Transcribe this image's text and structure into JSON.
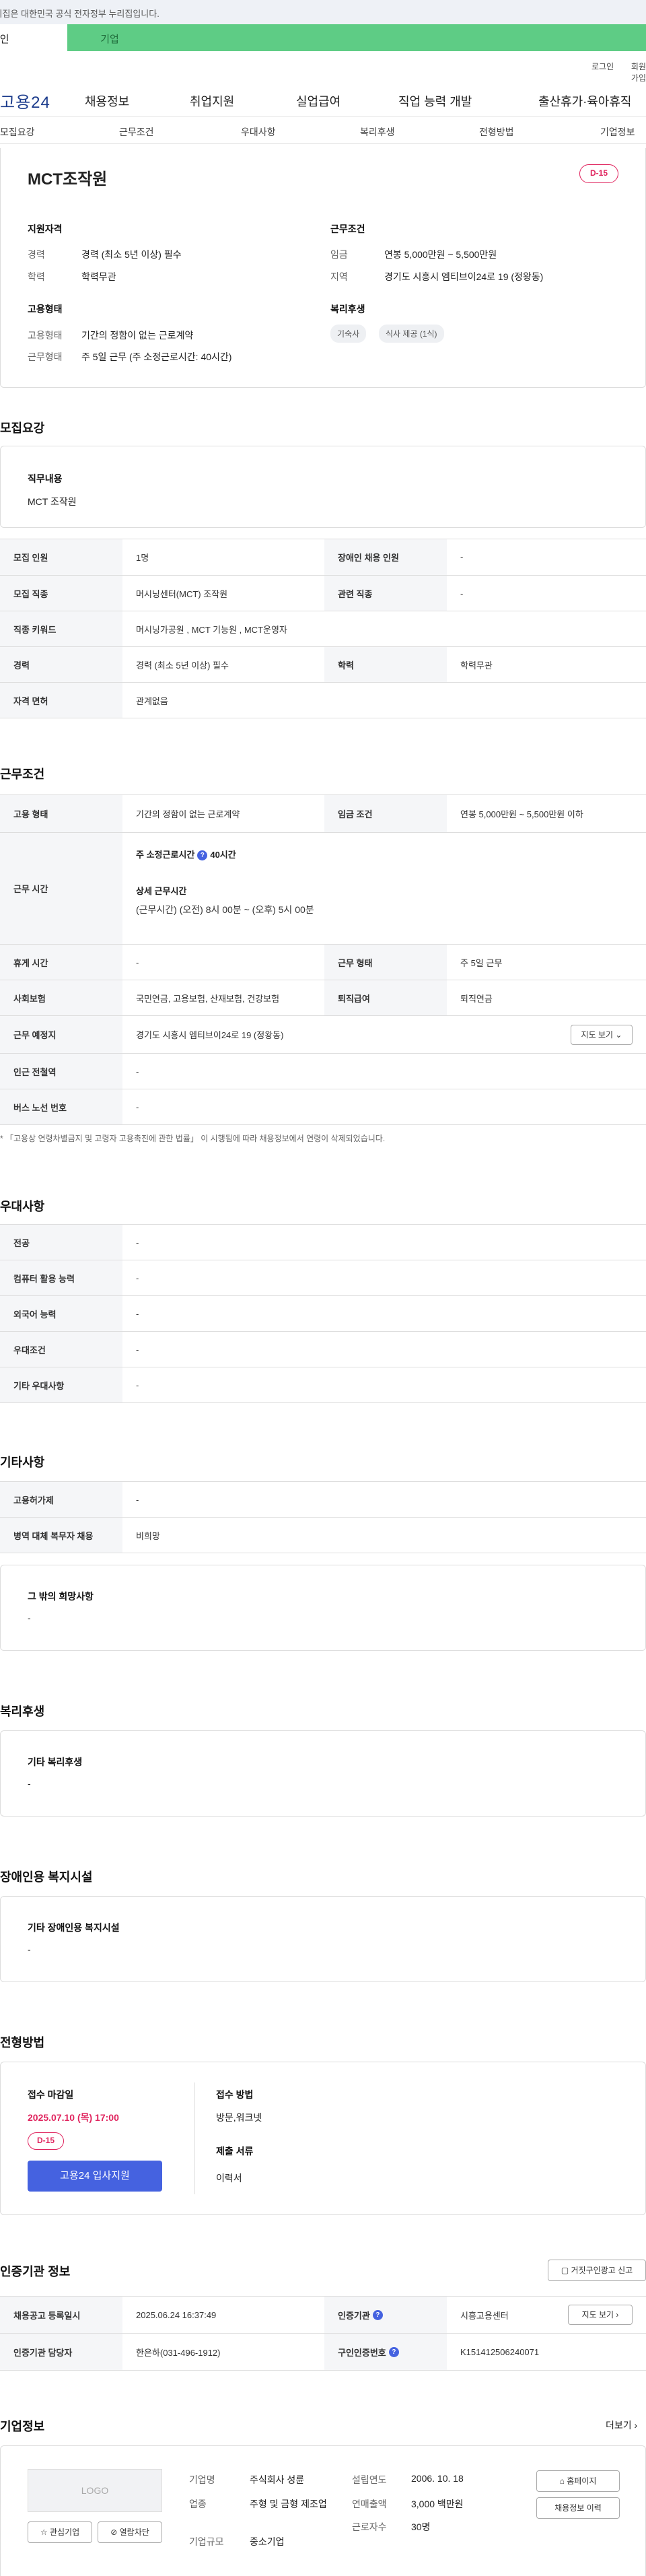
{
  "gov_notice": "이 누리집은 대한민국 공식 전자정부 누리집입니다.",
  "user_tabs": {
    "personal": "개인",
    "company": "기업"
  },
  "util": {
    "login": "로그인",
    "join": "회원가입"
  },
  "brand": "고용24",
  "nav": [
    "채용정보",
    "취업지원",
    "실업급여",
    "직업 능력 개발",
    "출산휴가·육아휴직"
  ],
  "subnav": [
    "모집요강",
    "근무조건",
    "우대사항",
    "복리후생",
    "전형방법",
    "기업정보"
  ],
  "header": {
    "title": "MCT조작원",
    "dday": "D-15",
    "qual_title": "지원자격",
    "qual": [
      {
        "k": "경력",
        "v": "경력 (최소 5년 이상) 필수"
      },
      {
        "k": "학력",
        "v": "학력무관"
      }
    ],
    "cond_title": "근무조건",
    "cond": [
      {
        "k": "임금",
        "v": "연봉 5,000만원 ~ 5,500만원"
      },
      {
        "k": "지역",
        "v": "경기도 시흥시 엠티브이24로 19 (정왕동)"
      }
    ],
    "type_title": "고용형태",
    "type": [
      {
        "k": "고용형태",
        "v": "기간의 정함이 없는 근로계약"
      },
      {
        "k": "근무형태",
        "v": "주 5일 근무 (주 소정근로시간: 40시간)"
      }
    ],
    "welfare_title": "복리후생",
    "welfare": [
      "기숙사",
      "식사 제공 (1식)"
    ]
  },
  "recruit": {
    "title": "모집요강",
    "job_label": "직무내용",
    "job_value": "MCT 조작원",
    "rows": [
      {
        "a": "모집 인원",
        "b": "1명",
        "c": "장애인 채용 인원",
        "d": "-"
      },
      {
        "a": "모집 직종",
        "b": "머시닝센터(MCT) 조작원",
        "c": "관련 직종",
        "d": "-"
      },
      {
        "a": "직종 키워드",
        "b": "머시닝가공원 , MCT 기능원 , MCT운영자"
      },
      {
        "a": "경력",
        "b": "경력 (최소 5년 이상) 필수",
        "c": "학력",
        "d": "학력무관"
      },
      {
        "a": "자격 면허",
        "b": "관계없음"
      }
    ]
  },
  "work": {
    "title": "근무조건",
    "type_k": "고용 형태",
    "type_v": "기간의 정함이 없는 근로계약",
    "wage_k": "임금 조건",
    "wage_v": "연봉 5,000만원 ~ 5,500만원 이하",
    "hours_k": "근무 시간",
    "hours_main": "주 소정근로시간",
    "hours_main_v": "40시간",
    "hours_detail_t": "상세 근무시간",
    "hours_detail_v": "(근무시간) (오전) 8시 00분 ~ (오후) 5시 00분",
    "rest_k": "휴게 시간",
    "rest_v": "-",
    "form_k": "근무 형태",
    "form_v": "주 5일 근무",
    "ins_k": "사회보험",
    "ins_v": "국민연금, 고용보험, 산재보험, 건강보험",
    "ret_k": "퇴직급여",
    "ret_v": "퇴직연금",
    "place_k": "근무 예정지",
    "place_v": "경기도 시흥시 엠티브이24로 19 (정왕동)",
    "map_btn": "지도 보기",
    "sub_k": "인근 전철역",
    "sub_v": "-",
    "bus_k": "버스 노선 번호",
    "bus_v": "-",
    "note": "* 「고용상 연령차별금지 및 고령자 고용촉진에 관한 법률」 이 시행됨에 따라 채용정보에서 연령이 삭제되었습니다."
  },
  "pref": {
    "title": "우대사항",
    "rows": [
      {
        "k": "전공",
        "v": "-"
      },
      {
        "k": "컴퓨터 활용 능력",
        "v": "-"
      },
      {
        "k": "외국어 능력",
        "v": "-"
      },
      {
        "k": "우대조건",
        "v": "-"
      },
      {
        "k": "기타 우대사항",
        "v": "-"
      }
    ]
  },
  "etc": {
    "title": "기타사항",
    "rows": [
      {
        "k": "고용허가제",
        "v": "-"
      },
      {
        "k": "병역 대체 복무자 채용",
        "v": "비희망"
      }
    ],
    "box_t": "그 밖의 희망사항",
    "box_v": "-"
  },
  "welfare": {
    "title": "복리후생",
    "box_t": "기타 복리후생",
    "box_v": "-"
  },
  "disab": {
    "title": "장애인용 복지시설",
    "box_t": "기타 장애인용 복지시설",
    "box_v": "-"
  },
  "selection": {
    "title": "전형방법",
    "deadline_t": "접수 마감일",
    "deadline_v": "2025.07.10 (목) 17:00",
    "dday": "D-15",
    "apply_btn": "고용24 입사지원",
    "method_t": "접수 방법",
    "method_v": "방문,워크넷",
    "docs_t": "제출 서류",
    "docs_v": "이력서"
  },
  "cert": {
    "title": "인증기관 정보",
    "report_btn": "거짓구인광고 신고",
    "reg_k": "채용공고 등록일시",
    "reg_v": "2025.06.24 16:37:49",
    "org_k": "인증기관",
    "org_v": "시흥고용센터",
    "map_btn": "지도 보기",
    "mgr_k": "인증기관 담당자",
    "mgr_v": "한은하(031-496-1912)",
    "no_k": "구인인증번호",
    "no_v": "K151412506240071"
  },
  "company": {
    "title": "기업정보",
    "more": "더보기",
    "logo": "LOGO",
    "fav_btn": "관심기업",
    "block_btn": "열람차단",
    "name_k": "기업명",
    "name_v": "주식회사 성륜",
    "ind_k": "업종",
    "ind_v": "주형 및 금형 제조업",
    "scale_k": "기업규모",
    "scale_v": "중소기업",
    "year_k": "설립연도",
    "year_v": "2006. 10. 18",
    "sales_k": "연매출액",
    "sales_v": "3,000 백만원",
    "emp_k": "근로자수",
    "emp_v": "30명",
    "home_btn": "홈페이지",
    "hist_btn": "채용정보 이력"
  },
  "colors": {
    "accent": "#4562e0",
    "dday": "#e0245e",
    "tab_green": "#5ecc85"
  }
}
